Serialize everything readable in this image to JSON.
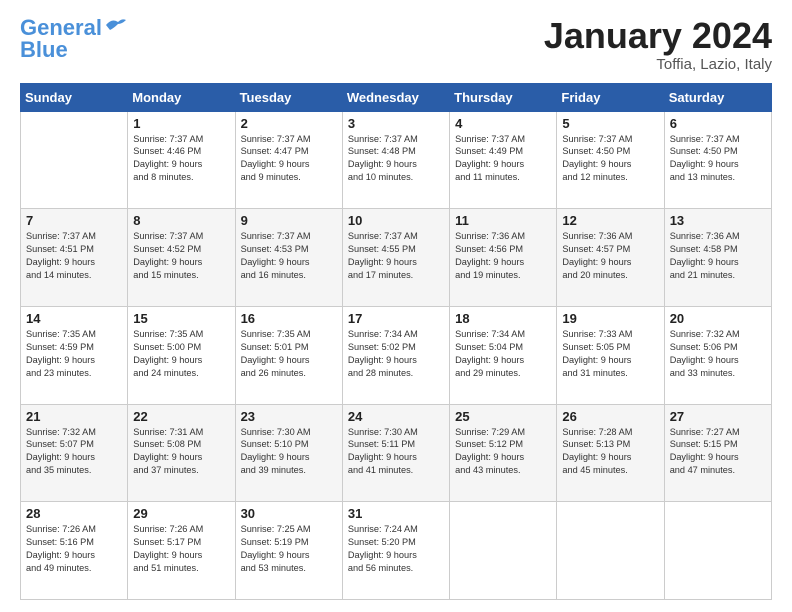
{
  "logo": {
    "line1": "General",
    "line2": "Blue"
  },
  "title": "January 2024",
  "location": "Toffia, Lazio, Italy",
  "header": {
    "days": [
      "Sunday",
      "Monday",
      "Tuesday",
      "Wednesday",
      "Thursday",
      "Friday",
      "Saturday"
    ]
  },
  "weeks": [
    [
      {
        "day": "",
        "text": ""
      },
      {
        "day": "1",
        "text": "Sunrise: 7:37 AM\nSunset: 4:46 PM\nDaylight: 9 hours\nand 8 minutes."
      },
      {
        "day": "2",
        "text": "Sunrise: 7:37 AM\nSunset: 4:47 PM\nDaylight: 9 hours\nand 9 minutes."
      },
      {
        "day": "3",
        "text": "Sunrise: 7:37 AM\nSunset: 4:48 PM\nDaylight: 9 hours\nand 10 minutes."
      },
      {
        "day": "4",
        "text": "Sunrise: 7:37 AM\nSunset: 4:49 PM\nDaylight: 9 hours\nand 11 minutes."
      },
      {
        "day": "5",
        "text": "Sunrise: 7:37 AM\nSunset: 4:50 PM\nDaylight: 9 hours\nand 12 minutes."
      },
      {
        "day": "6",
        "text": "Sunrise: 7:37 AM\nSunset: 4:50 PM\nDaylight: 9 hours\nand 13 minutes."
      }
    ],
    [
      {
        "day": "7",
        "text": "Sunrise: 7:37 AM\nSunset: 4:51 PM\nDaylight: 9 hours\nand 14 minutes."
      },
      {
        "day": "8",
        "text": "Sunrise: 7:37 AM\nSunset: 4:52 PM\nDaylight: 9 hours\nand 15 minutes."
      },
      {
        "day": "9",
        "text": "Sunrise: 7:37 AM\nSunset: 4:53 PM\nDaylight: 9 hours\nand 16 minutes."
      },
      {
        "day": "10",
        "text": "Sunrise: 7:37 AM\nSunset: 4:55 PM\nDaylight: 9 hours\nand 17 minutes."
      },
      {
        "day": "11",
        "text": "Sunrise: 7:36 AM\nSunset: 4:56 PM\nDaylight: 9 hours\nand 19 minutes."
      },
      {
        "day": "12",
        "text": "Sunrise: 7:36 AM\nSunset: 4:57 PM\nDaylight: 9 hours\nand 20 minutes."
      },
      {
        "day": "13",
        "text": "Sunrise: 7:36 AM\nSunset: 4:58 PM\nDaylight: 9 hours\nand 21 minutes."
      }
    ],
    [
      {
        "day": "14",
        "text": "Sunrise: 7:35 AM\nSunset: 4:59 PM\nDaylight: 9 hours\nand 23 minutes."
      },
      {
        "day": "15",
        "text": "Sunrise: 7:35 AM\nSunset: 5:00 PM\nDaylight: 9 hours\nand 24 minutes."
      },
      {
        "day": "16",
        "text": "Sunrise: 7:35 AM\nSunset: 5:01 PM\nDaylight: 9 hours\nand 26 minutes."
      },
      {
        "day": "17",
        "text": "Sunrise: 7:34 AM\nSunset: 5:02 PM\nDaylight: 9 hours\nand 28 minutes."
      },
      {
        "day": "18",
        "text": "Sunrise: 7:34 AM\nSunset: 5:04 PM\nDaylight: 9 hours\nand 29 minutes."
      },
      {
        "day": "19",
        "text": "Sunrise: 7:33 AM\nSunset: 5:05 PM\nDaylight: 9 hours\nand 31 minutes."
      },
      {
        "day": "20",
        "text": "Sunrise: 7:32 AM\nSunset: 5:06 PM\nDaylight: 9 hours\nand 33 minutes."
      }
    ],
    [
      {
        "day": "21",
        "text": "Sunrise: 7:32 AM\nSunset: 5:07 PM\nDaylight: 9 hours\nand 35 minutes."
      },
      {
        "day": "22",
        "text": "Sunrise: 7:31 AM\nSunset: 5:08 PM\nDaylight: 9 hours\nand 37 minutes."
      },
      {
        "day": "23",
        "text": "Sunrise: 7:30 AM\nSunset: 5:10 PM\nDaylight: 9 hours\nand 39 minutes."
      },
      {
        "day": "24",
        "text": "Sunrise: 7:30 AM\nSunset: 5:11 PM\nDaylight: 9 hours\nand 41 minutes."
      },
      {
        "day": "25",
        "text": "Sunrise: 7:29 AM\nSunset: 5:12 PM\nDaylight: 9 hours\nand 43 minutes."
      },
      {
        "day": "26",
        "text": "Sunrise: 7:28 AM\nSunset: 5:13 PM\nDaylight: 9 hours\nand 45 minutes."
      },
      {
        "day": "27",
        "text": "Sunrise: 7:27 AM\nSunset: 5:15 PM\nDaylight: 9 hours\nand 47 minutes."
      }
    ],
    [
      {
        "day": "28",
        "text": "Sunrise: 7:26 AM\nSunset: 5:16 PM\nDaylight: 9 hours\nand 49 minutes."
      },
      {
        "day": "29",
        "text": "Sunrise: 7:26 AM\nSunset: 5:17 PM\nDaylight: 9 hours\nand 51 minutes."
      },
      {
        "day": "30",
        "text": "Sunrise: 7:25 AM\nSunset: 5:19 PM\nDaylight: 9 hours\nand 53 minutes."
      },
      {
        "day": "31",
        "text": "Sunrise: 7:24 AM\nSunset: 5:20 PM\nDaylight: 9 hours\nand 56 minutes."
      },
      {
        "day": "",
        "text": ""
      },
      {
        "day": "",
        "text": ""
      },
      {
        "day": "",
        "text": ""
      }
    ]
  ]
}
